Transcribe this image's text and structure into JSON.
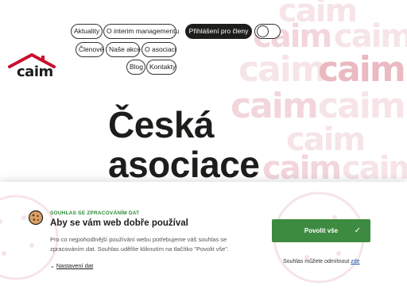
{
  "brand": {
    "logo_text": "caim",
    "watermark_text": "caim"
  },
  "nav": {
    "items": [
      "Aktuality",
      "O interim managementu",
      "Členové",
      "Naše akce",
      "O asociaci",
      "Blog",
      "Kontakty"
    ],
    "login_label": "Přihlášení pro členy"
  },
  "hero": {
    "line1": "Česká",
    "line2": "asociace"
  },
  "cookie": {
    "eyebrow": "SOUHLAS SE ZPRACOVÁNÍM DAT",
    "title": "Aby se vám web dobře používal",
    "body": "Pro co nejpohodlnější používání webu potřebujeme váš souhlas se zpracováním dat. Souhlas udělíte kliknutím na tlačítko \"Povolit vše\".",
    "settings_link": "Nastavení dat",
    "allow_label": "Povolit vše",
    "decline_prefix": "Souhlas můžete odmítnout ",
    "decline_link": "zde"
  },
  "colors": {
    "accent_green": "#3d8b40",
    "brand_red": "#c8102e",
    "text_dark": "#1d1d1b"
  }
}
